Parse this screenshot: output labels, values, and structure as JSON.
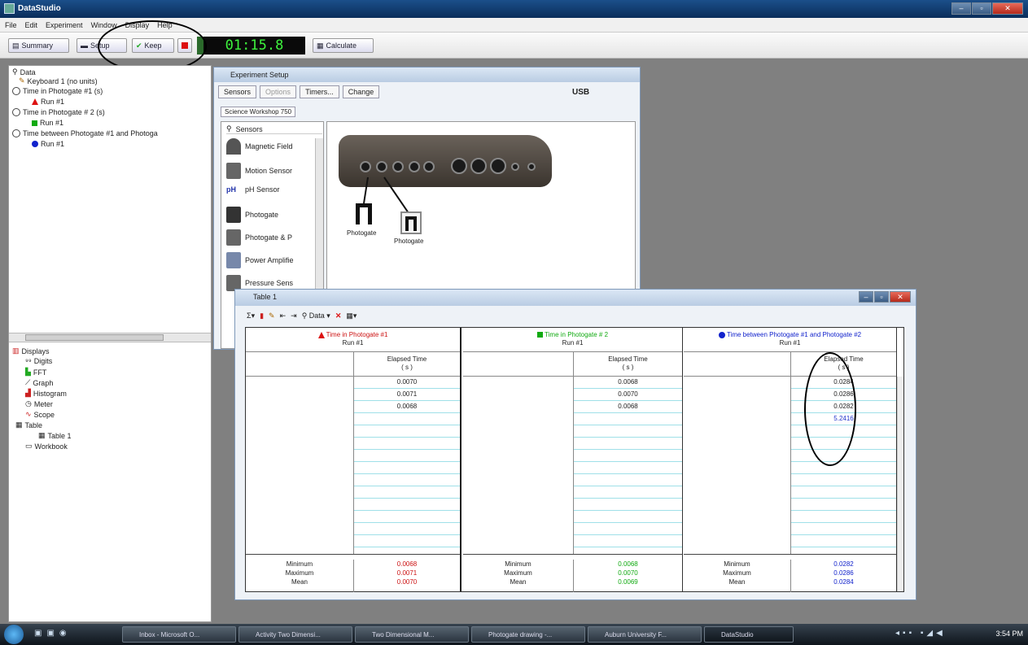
{
  "app": {
    "title": "DataStudio"
  },
  "menu": [
    "File",
    "Edit",
    "Experiment",
    "Window",
    "Display",
    "Help"
  ],
  "toolbar": {
    "summary": "Summary",
    "setup": "Setup",
    "keep": "Keep",
    "timer": "01:15.8",
    "calculate": "Calculate"
  },
  "data_tree": {
    "header": "Data",
    "items": [
      {
        "label": "Keyboard 1 (no units)"
      },
      {
        "label": "Time in Photogate #1 (s)"
      },
      {
        "label": "Run #1",
        "marker": "red-triangle"
      },
      {
        "label": "Time in Photogate # 2 (s)"
      },
      {
        "label": "Run #1",
        "marker": "green-square"
      },
      {
        "label": "Time between Photogate #1 and Photoga"
      },
      {
        "label": "Run #1",
        "marker": "blue-dot"
      }
    ]
  },
  "displays_tree": {
    "header": "Displays",
    "items": [
      "Digits",
      "FFT",
      "Graph",
      "Histogram",
      "Meter",
      "Scope",
      "Table",
      "Table 1",
      "Workbook"
    ]
  },
  "experiment_setup": {
    "title": "Experiment Setup",
    "tabs": [
      "Sensors",
      "Options",
      "Timers...",
      "Change"
    ],
    "connection": "USB",
    "interface_tab": "Science Workshop 750",
    "sensors_header": "Sensors",
    "sensors": [
      "Magnetic Field",
      "Motion Sensor",
      "pH Sensor",
      "Photogate",
      "Photogate & P",
      "Power Amplifie",
      "Pressure Sens"
    ],
    "ph_icon_text": "pH",
    "connected_labels": [
      "Photogate",
      "Photogate"
    ]
  },
  "table": {
    "title": "Table 1",
    "toolbar_data": "Data",
    "columns": [
      {
        "title": "Time in Photogate #1",
        "run": "Run #1",
        "color": "#cc1111",
        "header": "Elapsed Time",
        "unit": "( s )",
        "values": [
          "0.0070",
          "0.0071",
          "0.0068"
        ],
        "stats": {
          "labels": [
            "Minimum",
            "Maximum",
            "Mean"
          ],
          "values": [
            "0.0068",
            "0.0071",
            "0.0070"
          ]
        }
      },
      {
        "title": "Time in Photogate # 2",
        "run": "Run #1",
        "color": "#11aa11",
        "header": "Elapsed Time",
        "unit": "( s )",
        "values": [
          "0.0068",
          "0.0070",
          "0.0068"
        ],
        "stats": {
          "labels": [
            "Minimum",
            "Maximum",
            "Mean"
          ],
          "values": [
            "0.0068",
            "0.0070",
            "0.0069"
          ]
        }
      },
      {
        "title": "Time between Photogate #1 and Photogate #2",
        "run": "Run #1",
        "color": "#1122cc",
        "header": "Elapsed Time",
        "unit": "( s )",
        "values": [
          "0.0284",
          "0.0286",
          "0.0282",
          "5.2416"
        ],
        "stats": {
          "labels": [
            "Minimum",
            "Maximum",
            "Mean"
          ],
          "values": [
            "0.0282",
            "0.0286",
            "0.0284"
          ]
        }
      }
    ]
  },
  "taskbar": {
    "items": [
      "Inbox - Microsoft O...",
      "Activity Two Dimensi...",
      "Two Dimensional M...",
      "Photogate drawing -...",
      "Auburn University F...",
      "DataStudio"
    ],
    "clock": "3:54 PM"
  }
}
